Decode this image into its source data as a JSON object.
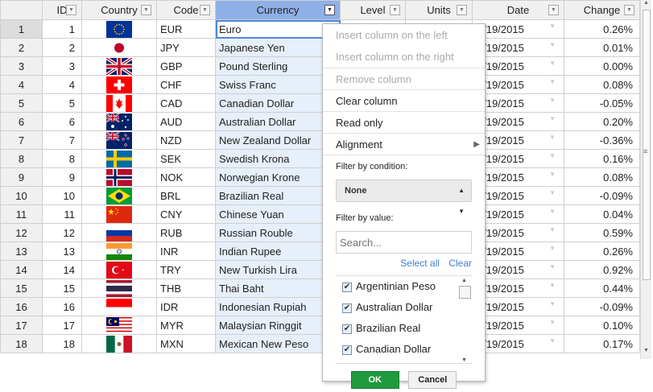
{
  "columns": [
    {
      "key": "rowhead",
      "label": ""
    },
    {
      "key": "id",
      "label": "ID"
    },
    {
      "key": "country",
      "label": "Country"
    },
    {
      "key": "code",
      "label": "Code"
    },
    {
      "key": "currency",
      "label": "Currency"
    },
    {
      "key": "level",
      "label": "Level"
    },
    {
      "key": "units",
      "label": "Units"
    },
    {
      "key": "date",
      "label": "Date"
    },
    {
      "key": "change",
      "label": "Change"
    }
  ],
  "rows": [
    {
      "n": "1",
      "id": "1",
      "flag": "eu",
      "code": "EUR",
      "currency": "Euro",
      "date": "8/19/2015",
      "change": "0.26%"
    },
    {
      "n": "2",
      "id": "2",
      "flag": "jp",
      "code": "JPY",
      "currency": "Japanese Yen",
      "date": "8/19/2015",
      "change": "0.01%"
    },
    {
      "n": "3",
      "id": "3",
      "flag": "gb",
      "code": "GBP",
      "currency": "Pound Sterling",
      "date": "8/19/2015",
      "change": "0.00%"
    },
    {
      "n": "4",
      "id": "4",
      "flag": "ch",
      "code": "CHF",
      "currency": "Swiss Franc",
      "date": "8/19/2015",
      "change": "0.08%"
    },
    {
      "n": "5",
      "id": "5",
      "flag": "ca",
      "code": "CAD",
      "currency": "Canadian Dollar",
      "date": "8/19/2015",
      "change": "-0.05%"
    },
    {
      "n": "6",
      "id": "6",
      "flag": "au",
      "code": "AUD",
      "currency": "Australian Dollar",
      "date": "8/19/2015",
      "change": "0.20%"
    },
    {
      "n": "7",
      "id": "7",
      "flag": "nz",
      "code": "NZD",
      "currency": "New Zealand Dollar",
      "date": "8/19/2015",
      "change": "-0.36%"
    },
    {
      "n": "8",
      "id": "8",
      "flag": "se",
      "code": "SEK",
      "currency": "Swedish Krona",
      "date": "8/19/2015",
      "change": "0.16%"
    },
    {
      "n": "9",
      "id": "9",
      "flag": "no",
      "code": "NOK",
      "currency": "Norwegian Krone",
      "date": "8/19/2015",
      "change": "0.08%"
    },
    {
      "n": "10",
      "id": "10",
      "flag": "br",
      "code": "BRL",
      "currency": "Brazilian Real",
      "date": "8/19/2015",
      "change": "-0.09%"
    },
    {
      "n": "11",
      "id": "11",
      "flag": "cn",
      "code": "CNY",
      "currency": "Chinese Yuan",
      "date": "8/19/2015",
      "change": "0.04%"
    },
    {
      "n": "12",
      "id": "12",
      "flag": "ru",
      "code": "RUB",
      "currency": "Russian Rouble",
      "date": "8/19/2015",
      "change": "0.59%"
    },
    {
      "n": "13",
      "id": "13",
      "flag": "in",
      "code": "INR",
      "currency": "Indian Rupee",
      "date": "8/19/2015",
      "change": "0.26%"
    },
    {
      "n": "14",
      "id": "14",
      "flag": "tr",
      "code": "TRY",
      "currency": "New Turkish Lira",
      "date": "8/19/2015",
      "change": "0.92%"
    },
    {
      "n": "15",
      "id": "15",
      "flag": "th",
      "code": "THB",
      "currency": "Thai Baht",
      "date": "8/19/2015",
      "change": "0.44%"
    },
    {
      "n": "16",
      "id": "16",
      "flag": "id",
      "code": "IDR",
      "currency": "Indonesian Rupiah",
      "date": "8/19/2015",
      "change": "-0.09%"
    },
    {
      "n": "17",
      "id": "17",
      "flag": "my",
      "code": "MYR",
      "currency": "Malaysian Ringgit",
      "date": "8/19/2015",
      "change": "0.10%"
    },
    {
      "n": "18",
      "id": "18",
      "flag": "mx",
      "code": "MXN",
      "currency": "Mexican New Peso",
      "date": "8/19/2015",
      "change": "0.17%"
    }
  ],
  "menu": {
    "insert_left": "Insert column on the left",
    "insert_right": "Insert column on the right",
    "remove_column": "Remove column",
    "clear_column": "Clear column",
    "read_only": "Read only",
    "alignment": "Alignment",
    "filter_by_condition": "Filter by condition:",
    "condition_value": "None",
    "filter_by_value": "Filter by value:",
    "search_placeholder": "Search...",
    "select_all": "Select all",
    "clear": "Clear",
    "values": [
      "Argentinian Peso",
      "Australian Dollar",
      "Brazilian Real",
      "Canadian Dollar"
    ],
    "ok": "OK",
    "cancel": "Cancel"
  },
  "icons": {
    "header_filter": "filter-dropdown-icon",
    "submenu": "chevron-right-icon",
    "select_caret": "up-down-caret-icon",
    "checkbox": "checkmark-icon"
  },
  "colors": {
    "selected_header": "#8eb0e7",
    "selected_column": "#e6effa",
    "active_cell_border": "#4b89dc",
    "ok_button": "#1f9a3c",
    "link": "#3e7ed1"
  }
}
